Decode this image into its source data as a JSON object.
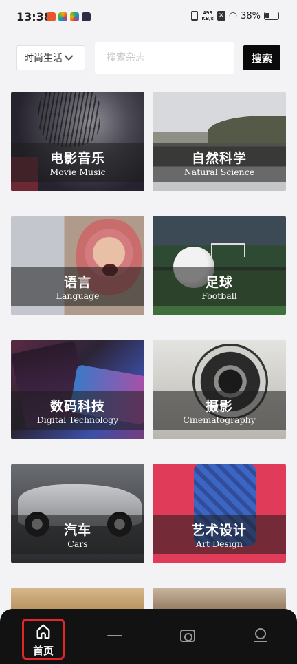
{
  "status_bar": {
    "time": "13:38",
    "net_speed": "499\nKB/s",
    "battery": "38%"
  },
  "search": {
    "category": "时尚生活",
    "placeholder": "搜索杂志",
    "button": "搜索"
  },
  "categories": [
    {
      "cn": "电影音乐",
      "en": "Movie Music"
    },
    {
      "cn": "自然科学",
      "en": "Natural Science"
    },
    {
      "cn": "语言",
      "en": "Language"
    },
    {
      "cn": "足球",
      "en": "Football"
    },
    {
      "cn": "数码科技",
      "en": "Digital Technology"
    },
    {
      "cn": "摄影",
      "en": "Cinematography"
    },
    {
      "cn": "汽车",
      "en": "Cars"
    },
    {
      "cn": "艺术设计",
      "en": "Art Design"
    }
  ],
  "bottom_nav": {
    "home": "首页"
  }
}
